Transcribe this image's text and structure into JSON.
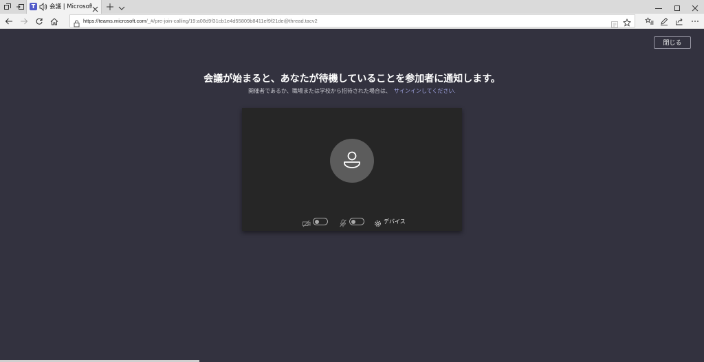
{
  "tab": {
    "title": "会議 | Microsoft Teams",
    "favicon_letter": "T",
    "favicon_color": "#5059c9"
  },
  "address_bar": {
    "url_host": "https://teams.microsoft.com",
    "url_path": "/_#/pre-join-calling/19:a08d9f31cb1e4d55809b8411ef9f21de@thread.tacv2"
  },
  "main": {
    "close_label": "閉じる",
    "heading": "会議が始まると、あなたが待機していることを参加者に通知します。",
    "subtext": "開催者であるか、職場または学校から招待された場合は、",
    "signin_link": "サインインしてください.",
    "device_label": "デバイス"
  },
  "colors": {
    "background": "#33323f",
    "preview": "#262626",
    "accent": "#9fa3e0"
  },
  "states": {
    "camera_on": false,
    "mic_on": false
  }
}
